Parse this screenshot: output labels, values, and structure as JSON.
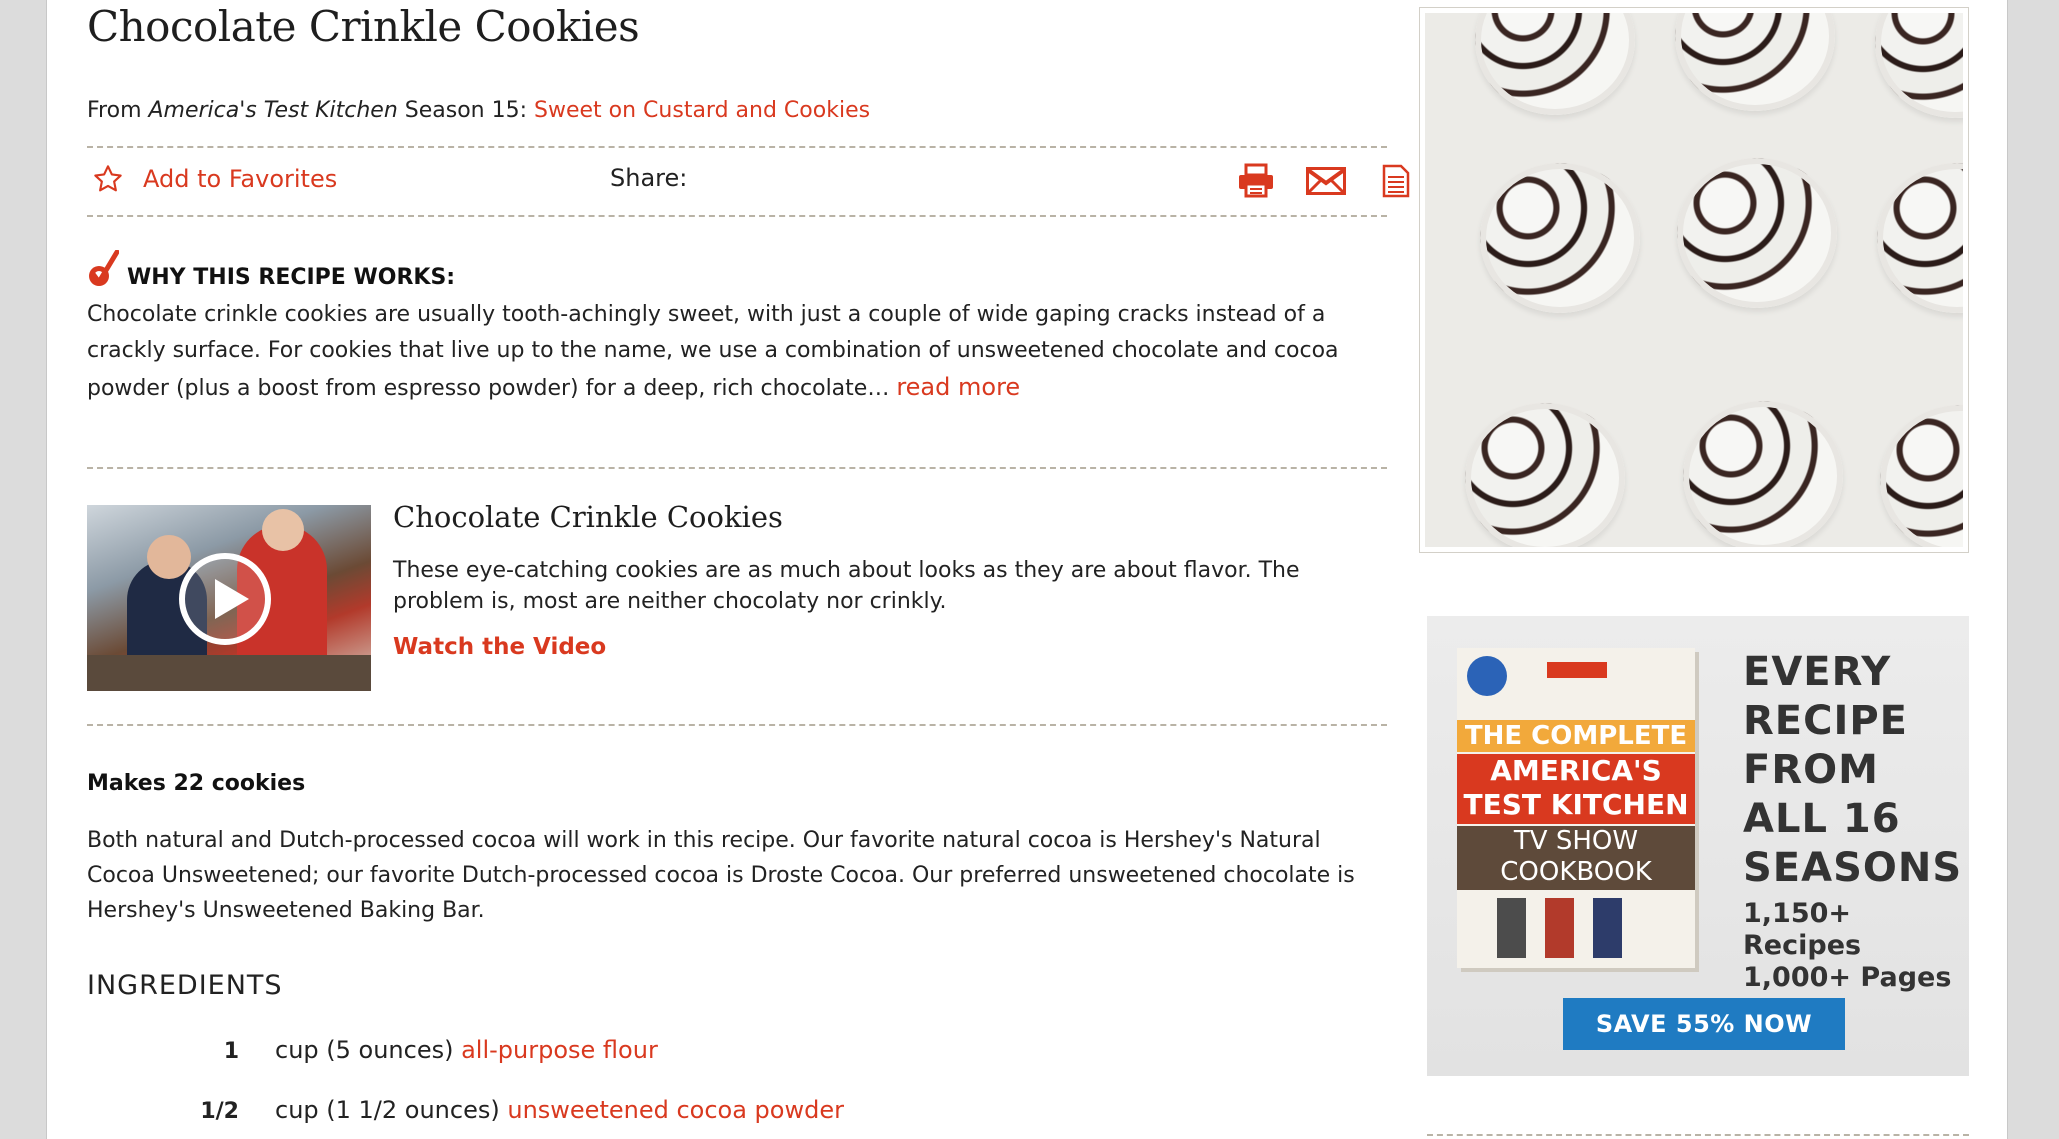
{
  "recipe": {
    "title": "Chocolate Crinkle Cookies",
    "from_prefix": "From ",
    "from_show": "America's Test Kitchen",
    "from_season": " Season 15: ",
    "from_episode": "Sweet on Custard and Cookies"
  },
  "actions": {
    "favorites_label": "Add to Favorites",
    "share_label": "Share:",
    "share_icons": [
      "print-icon",
      "email-icon",
      "document-icon"
    ]
  },
  "why": {
    "heading": "WHY THIS RECIPE WORKS:",
    "body": "Chocolate crinkle cookies are usually tooth-achingly sweet, with just a couple of wide gaping cracks instead of a crackly surface. For cookies that live up to the name, we use a combination of unsweetened chocolate and cocoa powder (plus a boost from espresso powder) for a deep, rich chocolate…",
    "read_more": "read more"
  },
  "video": {
    "title": "Chocolate Crinkle Cookies",
    "description": "These eye-catching cookies are as much about looks as they are about flavor. The problem is, most are neither chocolaty nor crinkly.",
    "link": "Watch the Video"
  },
  "yield": "Makes 22 cookies",
  "note": "Both natural and Dutch-processed cocoa will work in this recipe. Our favorite natural cocoa is Hershey's Natural Cocoa Unsweetened; our favorite Dutch-processed cocoa is Droste Cocoa. Our preferred unsweetened chocolate is Hershey's Unsweetened Baking Bar.",
  "ingredients": {
    "heading": "INGREDIENTS",
    "items": [
      {
        "qty": "1",
        "measure": "cup (5 ounces) ",
        "item": "all-purpose flour"
      },
      {
        "qty": "1/2",
        "measure": "cup (1 1/2 ounces) ",
        "item": "unsweetened cocoa powder"
      }
    ]
  },
  "ad": {
    "book_top": "THE COMPLETE",
    "book_mid": "AMERICA'S TEST KITCHEN",
    "book_bottom": "TV SHOW COOKBOOK",
    "headline": "EVERY RECIPE FROM ALL 16 SEASONS",
    "line1": "1,150+ Recipes",
    "line2": "1,000+ Pages",
    "button": "SAVE 55% NOW"
  },
  "colors": {
    "accent": "#d9391f",
    "button_blue": "#1f7bc2"
  }
}
